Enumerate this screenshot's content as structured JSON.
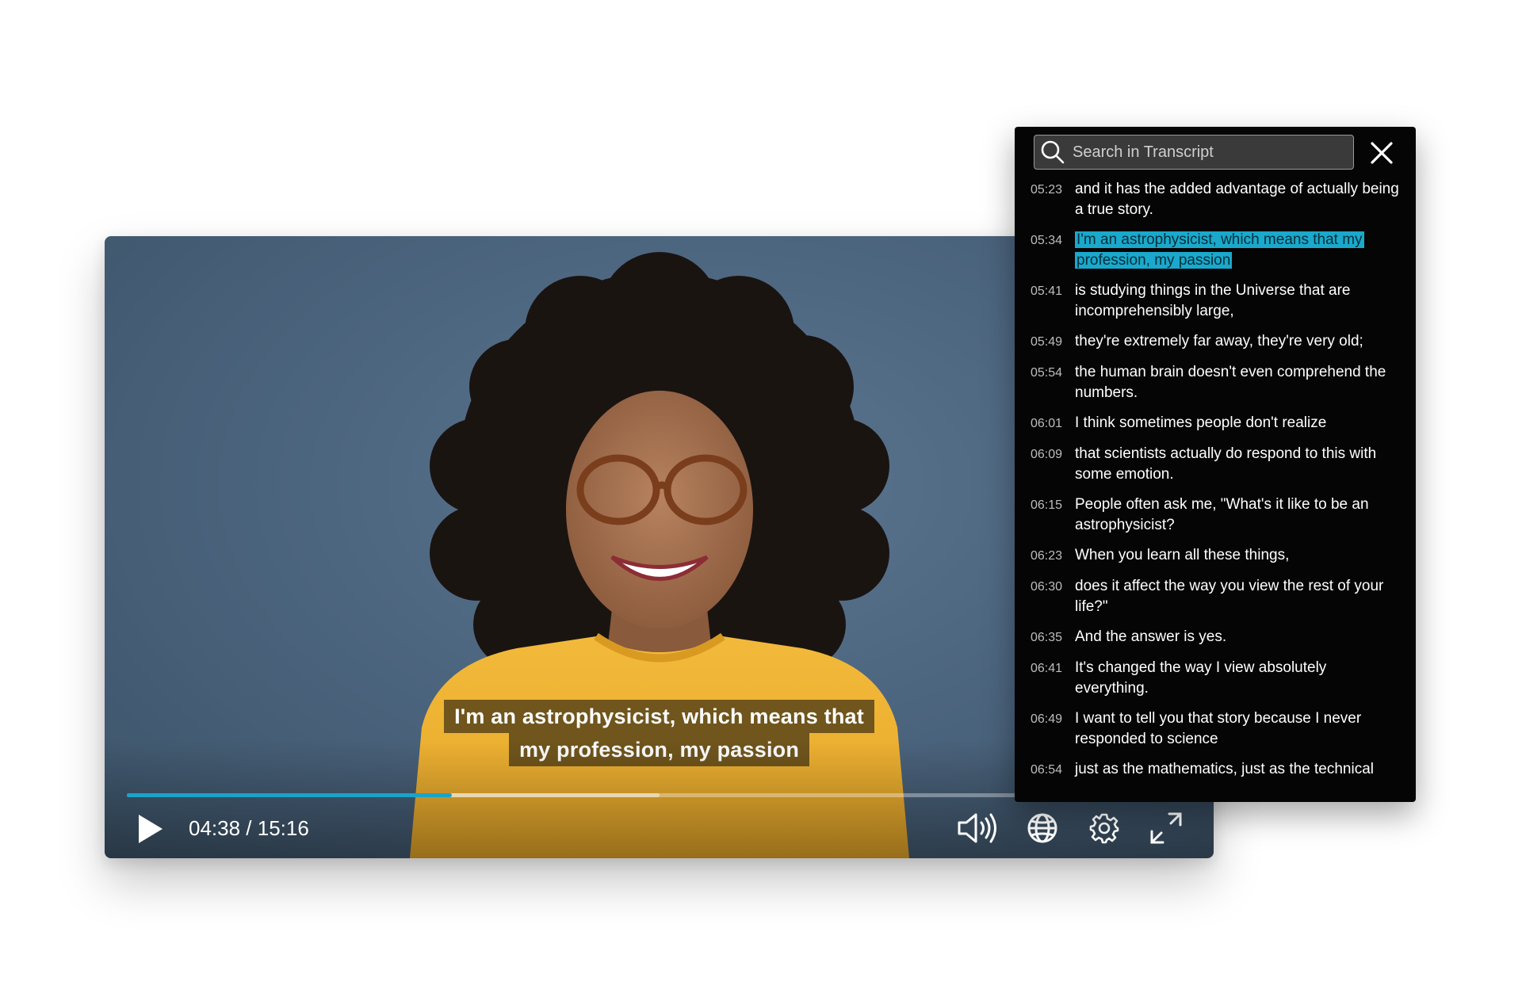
{
  "player": {
    "subtitle_lines": [
      "I'm an astrophysicist, which means that",
      "my profession, my passion"
    ],
    "time_display": "04:38 / 15:16",
    "progress_played": 0.3055,
    "progress_buffered": 0.5,
    "accent_color": "#1aa3c9",
    "icons": [
      "play-icon",
      "volume-icon",
      "globe-icon",
      "gear-icon",
      "fullscreen-icon"
    ]
  },
  "transcript": {
    "search_placeholder": "Search in Transcript",
    "active_index": 1,
    "highlight_color": "#1aa9cc",
    "lines": [
      {
        "time": "05:23",
        "text": "and it has the added advantage of actually being a true story."
      },
      {
        "time": "05:34",
        "text": "I'm an astrophysicist, which means that my profession, my passion"
      },
      {
        "time": "05:41",
        "text": "is studying things in the Universe that are incomprehensibly large,"
      },
      {
        "time": "05:49",
        "text": "they're extremely far away, they're very old;"
      },
      {
        "time": "05:54",
        "text": "the human brain doesn't even comprehend the numbers."
      },
      {
        "time": "06:01",
        "text": "I think sometimes people don't realize"
      },
      {
        "time": "06:09",
        "text": "that scientists actually do respond to this with some emotion."
      },
      {
        "time": "06:15",
        "text": "People often ask me, \"What's it like to be an astrophysicist?"
      },
      {
        "time": "06:23",
        "text": "When you learn all these things,"
      },
      {
        "time": "06:30",
        "text": "does it affect the way you view the rest of your life?\""
      },
      {
        "time": "06:35",
        "text": "And the answer is yes."
      },
      {
        "time": "06:41",
        "text": "It's changed the way I view absolutely everything."
      },
      {
        "time": "06:49",
        "text": "I want to tell you that story because I never responded to science"
      },
      {
        "time": "06:54",
        "text": "just as the mathematics, just as the technical"
      }
    ]
  }
}
